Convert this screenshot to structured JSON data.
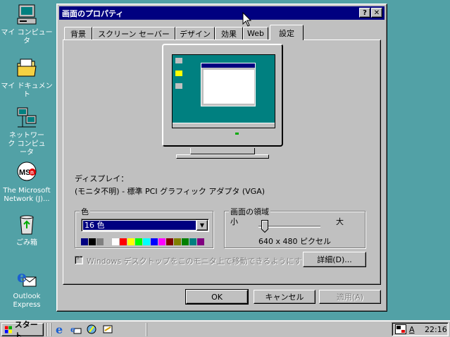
{
  "desktop": {
    "icons": [
      {
        "label": "マイ コンピュータ",
        "icon": "my-computer-icon"
      },
      {
        "label": "マイ ドキュメント",
        "icon": "my-documents-folder-icon"
      },
      {
        "label": "ネットワーク コンピュータ",
        "icon": "network-computer-icon"
      },
      {
        "label": "The Microsoft Network (J)...",
        "icon": "msn-icon"
      },
      {
        "label": "ごみ箱",
        "icon": "recycle-bin-icon"
      },
      {
        "label": "Outlook Express",
        "icon": "outlook-express-icon"
      }
    ]
  },
  "window": {
    "title": "画面のプロパティ",
    "help_label": "?",
    "close_label": "✕",
    "tabs": [
      "背景",
      "スクリーン セーバー",
      "デザイン",
      "効果",
      "Web",
      "設定"
    ],
    "active_tab": "設定",
    "display_label": "ディスプレイ：",
    "display_value": "(モニタ不明) - 標準 PCI グラフィック アダプタ (VGA)",
    "color_group_label": "色",
    "color_selected": "16 色",
    "palette": [
      "#000080",
      "#000000",
      "#808080",
      "#c0c0c0",
      "#ffffff",
      "#ff0000",
      "#ffff00",
      "#00ff00",
      "#00ffff",
      "#0000ff",
      "#ff00ff",
      "#800000",
      "#808000",
      "#008000",
      "#008080",
      "#800080"
    ],
    "area_group_label": "画面の領域",
    "area_small": "小",
    "area_large": "大",
    "resolution": "640 x 480 ピクセル",
    "extend_checkbox_label": "Windows デスクトップをこのモニタ上で移動できるようにする",
    "advanced_button": "詳細(D)...",
    "ok_button": "OK",
    "cancel_button": "キャンセル",
    "apply_button": "適用(A)"
  },
  "taskbar": {
    "start_label": "スタート",
    "quicklaunch": [
      "internet-explorer-icon",
      "outlook-express-icon",
      "channels-icon",
      "show-desktop-icon"
    ],
    "tray_ime": "A",
    "clock": "22:16"
  }
}
